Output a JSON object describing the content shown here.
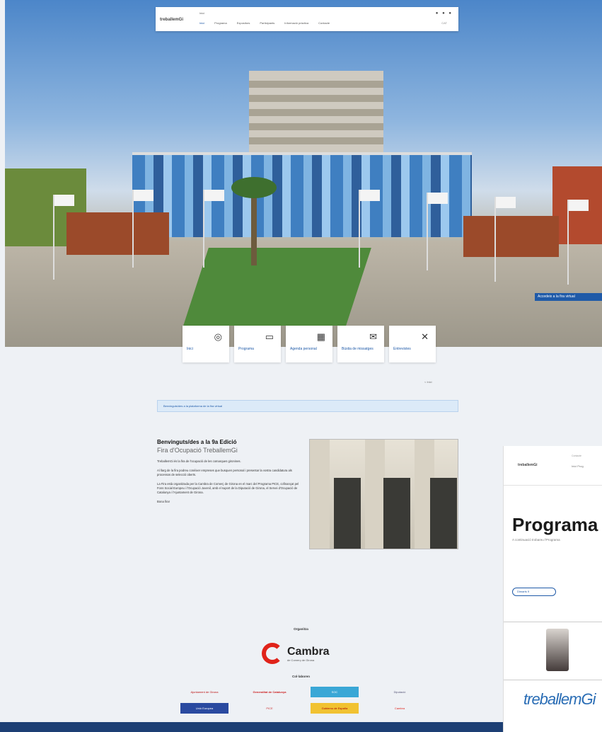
{
  "nav": {
    "logo": "treballemGi",
    "topline": "Inici",
    "menu": [
      "Inici",
      "Programa",
      "Expositors",
      "Participants",
      "Informació pràctica",
      "Contacte"
    ],
    "icons": "● ● ●",
    "lang": "CAT"
  },
  "hero": {
    "cta": "Accedeix a la fira virtual"
  },
  "tiles": [
    {
      "label": "Inici",
      "icon": "◎"
    },
    {
      "label": "Programa",
      "icon": "▭"
    },
    {
      "label": "Agenda personal",
      "icon": "▦"
    },
    {
      "label": "Bústia de missatges",
      "icon": "✉"
    },
    {
      "label": "Entrevistes",
      "icon": "✕"
    }
  ],
  "main": {
    "breadcrumb": "< Inici",
    "notice": "Benvinguts/des a la plataforma de la fira virtual",
    "welcome_title": "Benvinguts/des a la 9a Edició",
    "welcome_subtitle": "Fira d'Ocupació TreballemGi",
    "paragraphs": [
      "TreballemGi és la fira de l'ocupació de les comarques gironines.",
      "Al llarg de la fira podreu conèixer empreses que busquen personal i presentar la vostra candidatura als processos de selecció oberts.",
      "La Fira està organitzada per la Cambra de Comerç de Girona en el marc del Programa PICE, cofinançat pel Fons Social Europeu i l'Ocupació Juvenil, amb el suport de la Diputació de Girona, el Servei d'Ocupació de Catalunya i l'Ajuntament de Girona.",
      "Bona fira!"
    ]
  },
  "sponsors": {
    "title": "Organitza",
    "main_name": "Cambra",
    "main_sub": "de Comerç de Girona",
    "collab_title": "Col·laboren",
    "logos": [
      "Ajuntament de Girona",
      "Generalitat de Catalunya",
      "SOC",
      "Diputació",
      "Unió Europea",
      "PICE",
      "Gobierno de España",
      "Cambra"
    ]
  },
  "panel": {
    "logo": "treballemGi",
    "topline": "Contacte",
    "menu": "Inici Prog",
    "title": "Programa",
    "subtitle": "A continuació trobareu l'Programa",
    "pill": "Dimarts 9",
    "footer_logo": "treballemGi"
  }
}
